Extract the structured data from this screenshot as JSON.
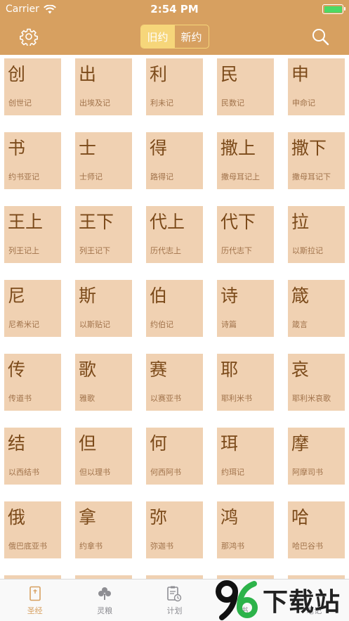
{
  "status": {
    "carrier": "Carrier",
    "time": "2:54 PM"
  },
  "nav": {
    "settings_icon": "gear-icon",
    "search_icon": "search-icon",
    "segments": [
      "旧约",
      "新约"
    ],
    "active_segment": 0
  },
  "books": [
    [
      {
        "abbr": "创",
        "name": "创世记"
      },
      {
        "abbr": "出",
        "name": "出埃及记"
      },
      {
        "abbr": "利",
        "name": "利未记"
      },
      {
        "abbr": "民",
        "name": "民数记"
      },
      {
        "abbr": "申",
        "name": "申命记"
      }
    ],
    [
      {
        "abbr": "书",
        "name": "约书亚记"
      },
      {
        "abbr": "士",
        "name": "士师记"
      },
      {
        "abbr": "得",
        "name": "路得记"
      },
      {
        "abbr": "撒上",
        "name": "撒母耳记上"
      },
      {
        "abbr": "撒下",
        "name": "撒母耳记下"
      }
    ],
    [
      {
        "abbr": "王上",
        "name": "列王记上"
      },
      {
        "abbr": "王下",
        "name": "列王记下"
      },
      {
        "abbr": "代上",
        "name": "历代志上"
      },
      {
        "abbr": "代下",
        "name": "历代志下"
      },
      {
        "abbr": "拉",
        "name": "以斯拉记"
      }
    ],
    [
      {
        "abbr": "尼",
        "name": "尼希米记"
      },
      {
        "abbr": "斯",
        "name": "以斯贴记"
      },
      {
        "abbr": "伯",
        "name": "约伯记"
      },
      {
        "abbr": "诗",
        "name": "诗篇"
      },
      {
        "abbr": "箴",
        "name": "箴言"
      }
    ],
    [
      {
        "abbr": "传",
        "name": "传道书"
      },
      {
        "abbr": "歌",
        "name": "雅歌"
      },
      {
        "abbr": "赛",
        "name": "以赛亚书"
      },
      {
        "abbr": "耶",
        "name": "耶利米书"
      },
      {
        "abbr": "哀",
        "name": "耶利米哀歌"
      }
    ],
    [
      {
        "abbr": "结",
        "name": "以西结书"
      },
      {
        "abbr": "但",
        "name": "但以理书"
      },
      {
        "abbr": "何",
        "name": "何西阿书"
      },
      {
        "abbr": "珥",
        "name": "约珥记"
      },
      {
        "abbr": "摩",
        "name": "阿摩司书"
      }
    ],
    [
      {
        "abbr": "俄",
        "name": "俄巴底亚书"
      },
      {
        "abbr": "拿",
        "name": "约拿书"
      },
      {
        "abbr": "弥",
        "name": "弥迦书"
      },
      {
        "abbr": "鸿",
        "name": "那鸿书"
      },
      {
        "abbr": "哈",
        "name": "哈巴谷书"
      }
    ]
  ],
  "tabs": [
    {
      "label": "圣经",
      "icon": "book-icon",
      "active": true
    },
    {
      "label": "灵粮",
      "icon": "clover-icon",
      "active": false
    },
    {
      "label": "计划",
      "icon": "clipboard-clock-icon",
      "active": false
    },
    {
      "label": "书",
      "icon": "note-icon",
      "active": false
    },
    {
      "label": "笔记",
      "icon": "pen-icon",
      "active": false
    }
  ],
  "watermark": {
    "number": "96",
    "text": "下载站"
  },
  "colors": {
    "accent": "#d7a060",
    "tile": "#f0d1b2",
    "tile_text": "#7b4a1a",
    "segment_active": "#f6d67a"
  }
}
